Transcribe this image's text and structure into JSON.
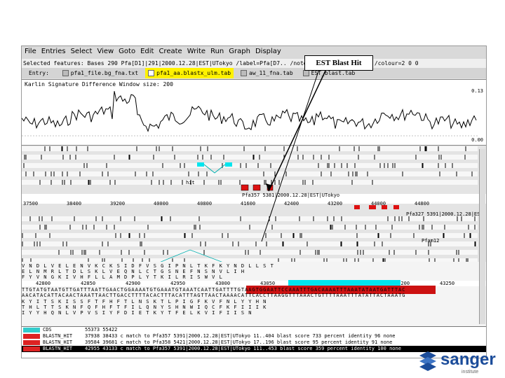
{
  "menu": [
    "File",
    "Entries",
    "Select",
    "View",
    "Goto",
    "Edit",
    "Create",
    "Write",
    "Run",
    "Graph",
    "Display"
  ],
  "selected_features": "Selected features:  Bases 290  Pfa[D1]|291|2000.12.28|EST|UTokyo  /label=Pfa[D7.. /note=\"UTokyo  /score=100 /colour=2 0 0",
  "entries": {
    "label": "Entry:",
    "items": [
      {
        "name": "pfa1_file.bg_fna.txt",
        "active": false
      },
      {
        "name": "pfa1_aa.blastx_ulm.tab",
        "active": true
      },
      {
        "name": "aw_11_fna.tab",
        "active": false
      },
      {
        "name": "EST_blast.tab",
        "active": false
      }
    ]
  },
  "callout": "EST Blast Hit",
  "plot": {
    "title": "Karlin Signature Difference  Window size: 200",
    "ymax": "0.13",
    "ymin": "0.00"
  },
  "ruler_top": [
    "37500",
    "38400",
    "39200",
    "40000",
    "40800",
    "41600",
    "42400",
    "43200",
    "44000",
    "44800"
  ],
  "ruler_mid": [
    "42800",
    "42850",
    "42900",
    "42950",
    "43000",
    "43050",
    "43100",
    "43150",
    "43200",
    "43250"
  ],
  "feature_labels": {
    "hit": "hit",
    "est1": "Pfa357 5381|2000.12.28|EST|UTokyo",
    "est2": "Pfa327 5391|2000.12.28|EST",
    "pfam": "Pfam12"
  },
  "seq": {
    "aa1": "V  N  D  L  V  E  L  E  N  V  K  C  K  S  I  D  F  V  S  G  I  P  N  L  T  K  F  K  Y  N  D  L  L  S  T",
    "aa2": "E  L  N  M  R  L  T  D  L  S  K  L  V  E  Q  N  L  C  T  G  S  N  E  F  N  S  N  V  L  I  H",
    "aa3": "F  Y  V  N  G  K  I  V  H  F  L  L  A  M  D  P  L  Y  T  K  I  L  R  I  S  W  V  L",
    "dna1": "TTGTATGTAATGTTGATTTAATTGAACTGGAAAATGTGAAATGTAAATCAATTGATTTTGTAAGTGGAATTCCAAATTTGACAAAATTTAAATATAATGATTTAC",
    "dna2": "AACATACATTACAACTAAATTAACTTGACCTTTTACACTTTACATTTAGTTAACTAAAACATTCACCTTAAGGTTTAAACTGTTTTAAATTTATATTACTAAATG",
    "aa4": "K  Y  I  T  S  K  I  S  S  F  T  F  H  F  T  L  N  S  K  T  L  P  I  G  F  K  V  F  N  L  Y  Y  H  N",
    "aa5": "T  H  L  T  T  S  K  N  F  Q  F  H  F  T  F  I  L  Q  N  Y  S  H  N  W  I  Q  C  F  K  F  I  I  I  K",
    "aa6": "I  Y  Y  H  Q  N  L  V  P  V  S  I  Y  F  D  I  E  T  K  Y  T  F  E  L  K  V  I  F  I  I  S  N"
  },
  "features": [
    {
      "key": "CDS",
      "text": "55373 55422",
      "color": "#33cccc",
      "selected": false
    },
    {
      "key": "BLASTN_HIT",
      "text": "37938 38433 c  match to Pfa357 5391|2000.12.28|EST|UTokyo 11..404 blast score 733  percent identity 96  none",
      "color": "#dd2222",
      "selected": false
    },
    {
      "key": "BLASTN_HIT",
      "text": "39584 39681 c  match to Pfa358 5421|2000.12.28|EST|UTokyo 17..196 blast score 95 percent identity 91 none",
      "color": "#dd2222",
      "selected": false
    },
    {
      "key": "BLASTN_HIT",
      "text": "42955 43133 c  match to Pfa357 5391|2000.12.28|EST|UTokyo 111..453 blast score 359 percent identity 100 none",
      "color": "#dd2222",
      "selected": true
    }
  ],
  "logo": {
    "brand": "sanger",
    "sub": "institute"
  },
  "colors": {
    "accent": "#00e5ee",
    "hit": "#dd1111",
    "highlight": "#fff200"
  }
}
